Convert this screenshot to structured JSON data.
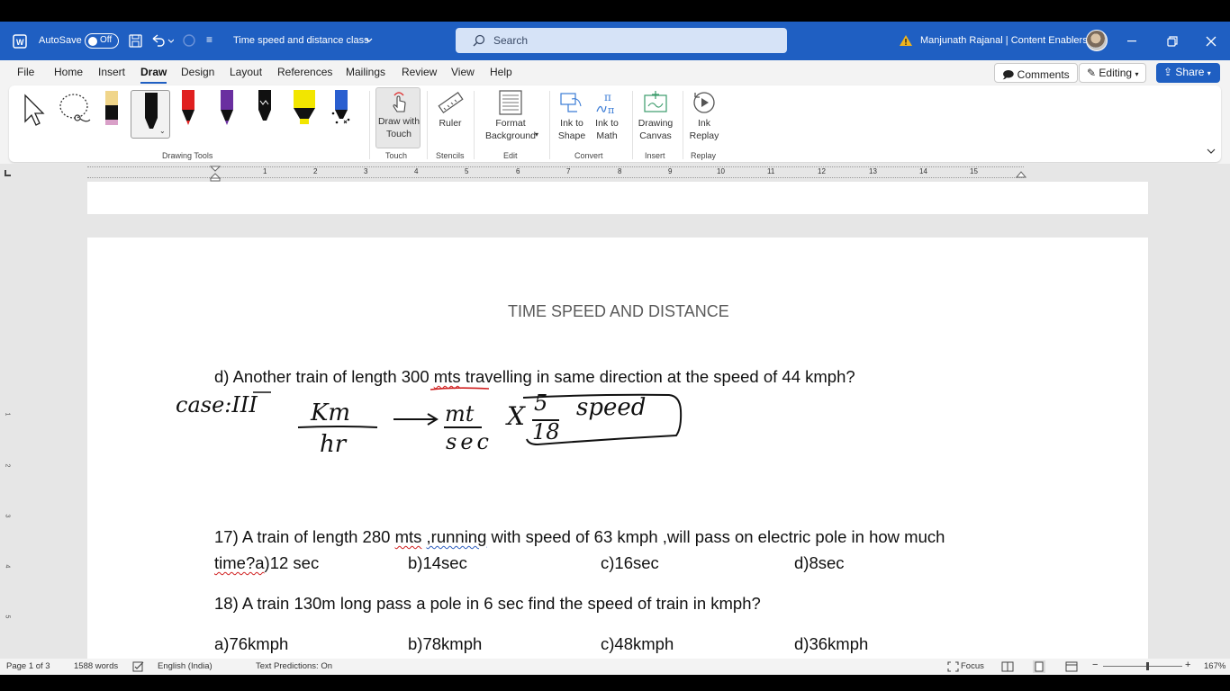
{
  "titlebar": {
    "autosave_label": "AutoSave",
    "autosave_state": "Off",
    "doc_title": "Time speed and distance class",
    "search_placeholder": "Search",
    "user_name": "Manjunath Rajanal | Content Enablers"
  },
  "tabs": [
    "File",
    "Home",
    "Insert",
    "Draw",
    "Design",
    "Layout",
    "References",
    "Mailings",
    "Review",
    "View",
    "Help"
  ],
  "active_tab": "Draw",
  "header_buttons": {
    "comments": "Comments",
    "editing": "Editing",
    "share": "Share"
  },
  "ribbon": {
    "groups": {
      "drawing_tools": "Drawing Tools",
      "touch": "Touch",
      "stencils": "Stencils",
      "edit": "Edit",
      "convert": "Convert",
      "insert": "Insert",
      "replay": "Replay"
    },
    "buttons": {
      "draw_with_touch_1": "Draw with",
      "draw_with_touch_2": "Touch",
      "ruler": "Ruler",
      "format_background_1": "Format",
      "format_background_2": "Background",
      "ink_to_shape_1": "Ink to",
      "ink_to_shape_2": "Shape",
      "ink_to_math_1": "Ink to",
      "ink_to_math_2": "Math",
      "drawing_canvas_1": "Drawing",
      "drawing_canvas_2": "Canvas",
      "ink_replay_1": "Ink",
      "ink_replay_2": "Replay"
    },
    "pens": [
      {
        "name": "highlighter-pink",
        "color": "#d9a0c8"
      },
      {
        "name": "pen-black-selected",
        "color": "#111111"
      },
      {
        "name": "pen-red",
        "color": "#e02020"
      },
      {
        "name": "pen-purple",
        "color": "#6a2fa0"
      },
      {
        "name": "pen-black-galaxy",
        "color": "#111111"
      },
      {
        "name": "highlighter-yellow",
        "color": "#f2e600"
      },
      {
        "name": "pen-blue-galaxy",
        "color": "#2a5fd0"
      }
    ]
  },
  "ruler": {
    "numbers": [
      "1",
      "2",
      "3",
      "4",
      "5",
      "6",
      "7",
      "8",
      "9",
      "10",
      "11",
      "12",
      "13",
      "14",
      "15"
    ],
    "vertical_numbers": [
      "1",
      "2",
      "3",
      "4",
      "5"
    ]
  },
  "document": {
    "title": "TIME SPEED AND DISTANCE",
    "q_d_part1": "d) Another train of length 300 ",
    "q_d_squig": "mts",
    "q_d_part2": " travelling in same direction at the speed of 44 kmph?",
    "q17_part1": "17) A train of length 280 ",
    "q17_squig1": "mts",
    "q17_part2": " ",
    "q17_squig2": ",running",
    "q17_part3": " with speed of 63 kmph ,will pass on electric pole in how much",
    "q17_line2_squig": "time?a",
    "q17_line2_a": ")12 sec",
    "q17_b": "b)14sec",
    "q17_c": "c)16sec",
    "q17_d": "d)8sec",
    "q18": "18)  A train 130m long pass a pole in 6 sec find the speed of train in kmph?",
    "q18_a": "a)76kmph",
    "q18_b": "b)78kmph",
    "q18_c": "c)48kmph",
    "q18_d": "d)36kmph"
  },
  "ink": {
    "case_label": "case:III",
    "km": "Km",
    "hr": "hr",
    "mt": "mt",
    "sec": "sec",
    "times": "X",
    "five": "5",
    "eighteen": "18",
    "speed": "speed"
  },
  "status": {
    "page": "Page 1 of 3",
    "words": "1588 words",
    "language": "English (India)",
    "text_predictions": "Text Predictions: On",
    "focus": "Focus",
    "zoom": "167%"
  },
  "colors": {
    "accent": "#1f5fc2",
    "ink": "#111111",
    "spelling_squiggle": "#d02020"
  }
}
